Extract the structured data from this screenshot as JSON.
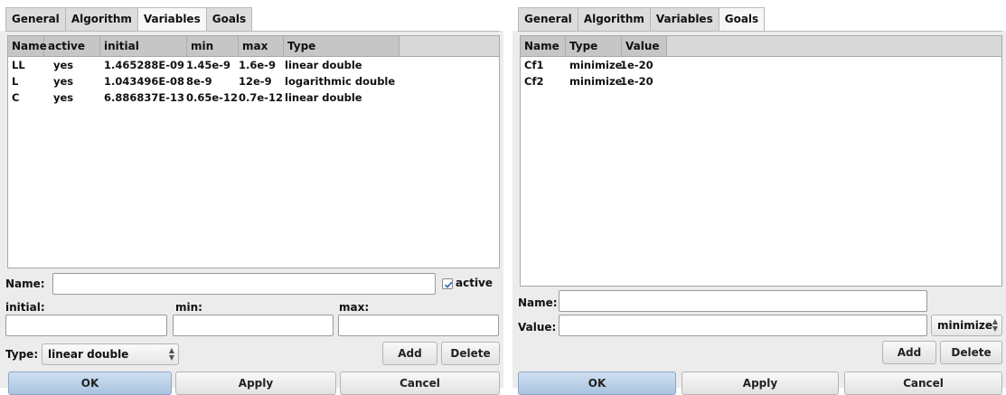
{
  "left": {
    "tabs": [
      "General",
      "Algorithm",
      "Variables",
      "Goals"
    ],
    "active_tab": 2,
    "columns": [
      "Name",
      "active",
      "initial",
      "min",
      "max",
      "Type"
    ],
    "rows": [
      {
        "name": "LL",
        "active": "yes",
        "initial": "1.465288E-09",
        "min": "1.45e-9",
        "max": "1.6e-9",
        "type": "linear double"
      },
      {
        "name": "L",
        "active": "yes",
        "initial": "1.043496E-08",
        "min": "8e-9",
        "max": "12e-9",
        "type": "logarithmic double"
      },
      {
        "name": "C",
        "active": "yes",
        "initial": "6.886837E-13",
        "min": "0.65e-12",
        "max": "0.7e-12",
        "type": "linear double"
      }
    ],
    "name_label": "Name:",
    "name_value": "",
    "active_checkbox_label": "active",
    "active_checked": true,
    "initial_label": "initial:",
    "min_label": "min:",
    "max_label": "max:",
    "type_label": "Type:",
    "type_value": "linear double",
    "add_label": "Add",
    "delete_label": "Delete",
    "ok_label": "OK",
    "apply_label": "Apply",
    "cancel_label": "Cancel"
  },
  "right": {
    "tabs": [
      "General",
      "Algorithm",
      "Variables",
      "Goals"
    ],
    "active_tab": 3,
    "columns": [
      "Name",
      "Type",
      "Value"
    ],
    "rows": [
      {
        "name": "Cf1",
        "type": "minimize",
        "value": "1e-20"
      },
      {
        "name": "Cf2",
        "type": "minimize",
        "value": "1e-20"
      }
    ],
    "name_label": "Name:",
    "value_label": "Value:",
    "goal_type_value": "minimize",
    "add_label": "Add",
    "delete_label": "Delete",
    "ok_label": "OK",
    "apply_label": "Apply",
    "cancel_label": "Cancel"
  },
  "icons": {
    "checkbox": "checkmark-icon",
    "spinner": "updown-arrows-icon"
  },
  "colors": {
    "ok_button": "#a9c3e0",
    "table_header": "#c6c6c6",
    "panel_bg": "#ececec"
  }
}
